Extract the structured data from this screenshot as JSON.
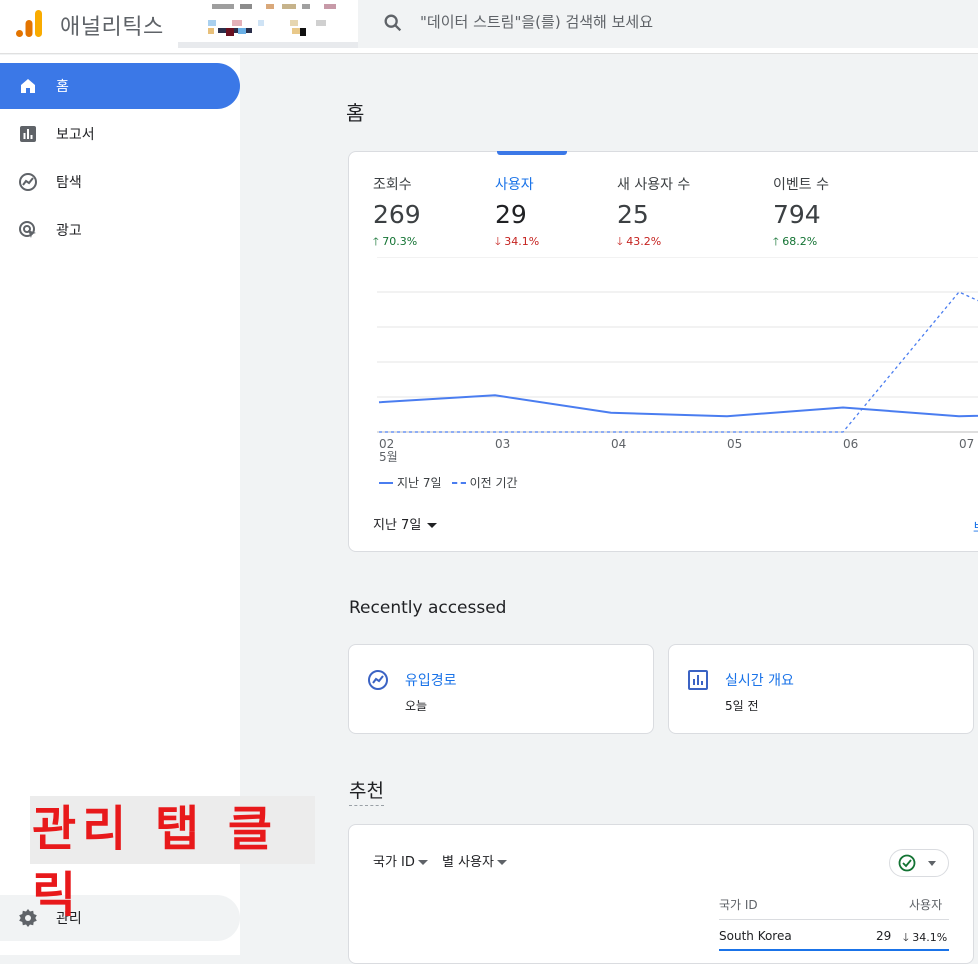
{
  "app": {
    "title": "애널리틱스"
  },
  "search": {
    "placeholder": "\"데이터 스트림\"을(를) 검색해 보세요"
  },
  "sidebar": {
    "items": [
      {
        "label": "홈",
        "icon": "home-icon",
        "active": true
      },
      {
        "label": "보고서",
        "icon": "bar-chart-icon",
        "active": false
      },
      {
        "label": "탐색",
        "icon": "explore-icon",
        "active": false
      },
      {
        "label": "광고",
        "icon": "ads-icon",
        "active": false
      }
    ],
    "admin_label": "관리"
  },
  "annotation": {
    "text": "관리 탭 클릭",
    "color": "#e8191b"
  },
  "main": {
    "title": "홈",
    "metrics": [
      {
        "name": "조회수",
        "value": "269",
        "change": "70.3%",
        "direction": "up"
      },
      {
        "name": "사용자",
        "value": "29",
        "change": "34.1%",
        "direction": "down"
      },
      {
        "name": "새 사용자 수",
        "value": "25",
        "change": "43.2%",
        "direction": "down"
      },
      {
        "name": "이벤트 수",
        "value": "794",
        "change": "68.2%",
        "direction": "up"
      }
    ],
    "legend": {
      "current": "지난 7일",
      "previous": "이전 기간"
    },
    "period_label": "지난 7일",
    "more_link": "보"
  },
  "chart_data": {
    "type": "line",
    "x": [
      "02",
      "03",
      "04",
      "05",
      "06",
      "07"
    ],
    "x_sublabel": "5월",
    "series": [
      {
        "name": "지난 7일",
        "style": "solid",
        "values": [
          8.5,
          10.5,
          5.5,
          4.5,
          7,
          4.5
        ]
      },
      {
        "name": "이전 기간",
        "style": "dashed",
        "values": [
          0,
          0,
          0,
          0,
          0,
          40
        ]
      }
    ],
    "grid": true,
    "colors": {
      "series": "#4a7df0"
    }
  },
  "recently_accessed": {
    "title": "Recently accessed",
    "items": [
      {
        "title": "유입경로",
        "subtitle": "오늘",
        "icon": "explore-icon"
      },
      {
        "title": "실시간 개요",
        "subtitle": "5일 전",
        "icon": "bar-chart-icon"
      }
    ]
  },
  "recommendations": {
    "title": "추천",
    "dim1": "국가 ID",
    "dim2": "별 사용자",
    "table": {
      "headers": [
        "국가 ID",
        "사용자"
      ],
      "rows": [
        {
          "country": "South Korea",
          "users": "29",
          "change": "34.1%"
        }
      ]
    }
  },
  "colors": {
    "accent": "#3b78e7",
    "up": "#137333",
    "down": "#c5221f"
  }
}
